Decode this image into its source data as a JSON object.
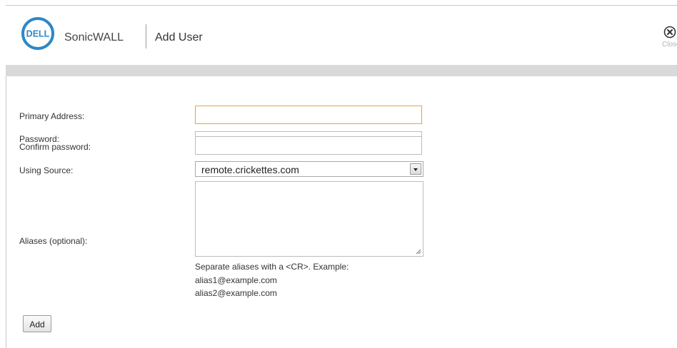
{
  "header": {
    "logo_text": "DELL",
    "brand": "SonicWALL",
    "title": "Add User",
    "close_label": "Close"
  },
  "form": {
    "primary_address": {
      "label": "Primary Address:",
      "value": ""
    },
    "password": {
      "label": "Password:",
      "value": ""
    },
    "confirm_password": {
      "label": "Confirm password:",
      "value": ""
    },
    "using_source": {
      "label": "Using Source:",
      "selected": "remote.crickettes.com"
    },
    "aliases": {
      "label": "Aliases (optional):",
      "value": "",
      "help_lines": [
        "Separate aliases with a <CR>. Example:",
        "alias1@example.com",
        "alias2@example.com"
      ]
    }
  },
  "actions": {
    "add_label": "Add"
  },
  "colors": {
    "dell_blue": "#2e87c9",
    "focus_border": "#e0a73b",
    "band": "#d9d9d9"
  },
  "icons": {
    "close": "close-circle-x-icon",
    "dropdown": "chevron-down-icon",
    "resize": "resize-grip-icon"
  }
}
